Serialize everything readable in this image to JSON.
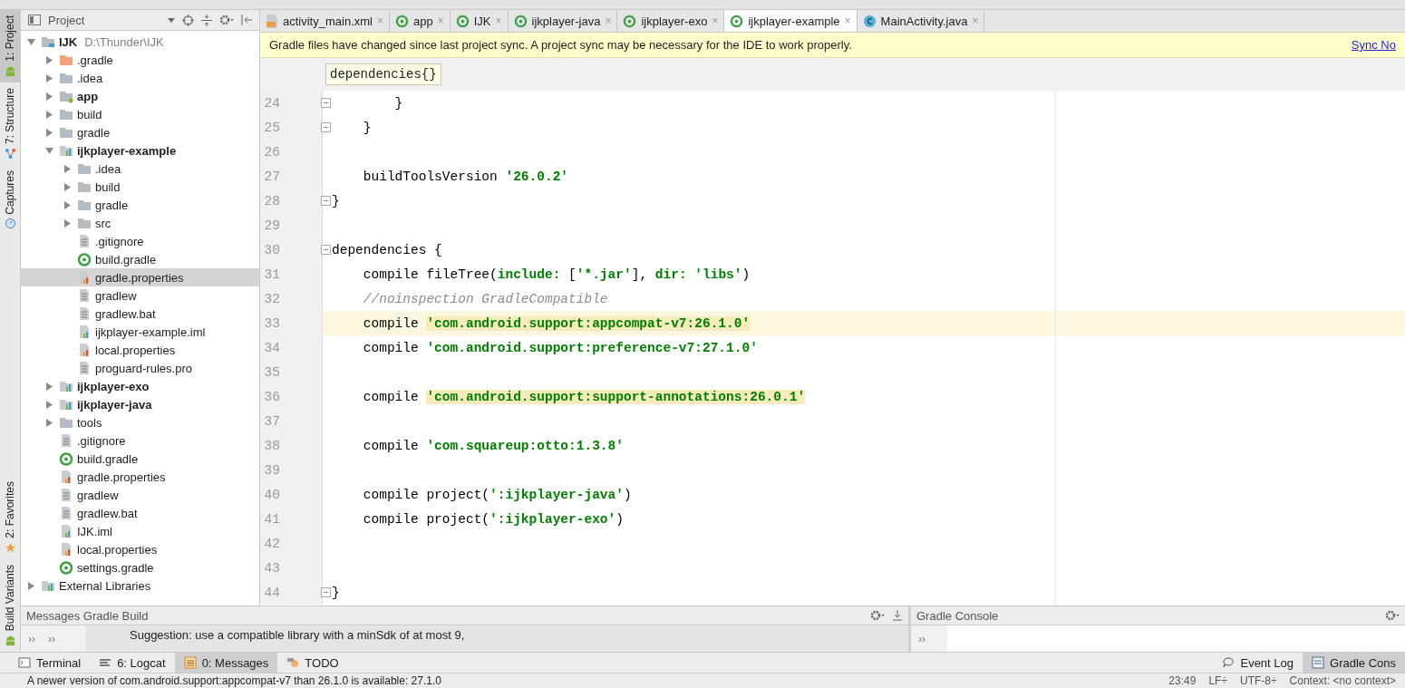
{
  "tool_strip": [
    {
      "label": "1: Project",
      "selected": true,
      "kind": "android"
    },
    {
      "label": "7: Structure",
      "selected": false,
      "kind": "structure"
    },
    {
      "label": "Captures",
      "selected": false,
      "kind": "camera"
    }
  ],
  "tool_strip_bottom": [
    {
      "label": "2: Favorites",
      "selected": false,
      "kind": "star"
    },
    {
      "label": "Build Variants",
      "selected": false,
      "kind": "android"
    }
  ],
  "project_panel": {
    "title": "Project",
    "tree": [
      {
        "label": "IJK",
        "path": "D:\\Thunder\\IJK",
        "kind": "project",
        "bold": true,
        "expanded": true,
        "selected": false,
        "children": [
          {
            "label": ".gradle",
            "kind": "folder-orange",
            "bold": false,
            "expanded": false,
            "selected": false
          },
          {
            "label": ".idea",
            "kind": "folder",
            "bold": false,
            "expanded": false,
            "selected": false
          },
          {
            "label": "app",
            "kind": "module-folder",
            "bold": true,
            "expanded": false,
            "selected": false
          },
          {
            "label": "build",
            "kind": "folder",
            "bold": false,
            "expanded": false,
            "selected": false
          },
          {
            "label": "gradle",
            "kind": "folder",
            "bold": false,
            "expanded": false,
            "selected": false
          },
          {
            "label": "ijkplayer-example",
            "kind": "module",
            "bold": true,
            "expanded": true,
            "selected": false,
            "children": [
              {
                "label": ".idea",
                "kind": "folder",
                "bold": false,
                "expanded": false,
                "selected": false
              },
              {
                "label": "build",
                "kind": "folder",
                "bold": false,
                "expanded": false,
                "selected": false
              },
              {
                "label": "gradle",
                "kind": "folder",
                "bold": false,
                "expanded": false,
                "selected": false
              },
              {
                "label": "src",
                "kind": "folder",
                "bold": false,
                "expanded": false,
                "selected": false
              },
              {
                "label": ".gitignore",
                "kind": "text",
                "bold": false,
                "selected": false
              },
              {
                "label": "build.gradle",
                "kind": "gradle",
                "bold": false,
                "selected": false
              },
              {
                "label": "gradle.properties",
                "kind": "properties",
                "bold": false,
                "selected": true
              },
              {
                "label": "gradlew",
                "kind": "text",
                "bold": false,
                "selected": false
              },
              {
                "label": "gradlew.bat",
                "kind": "text",
                "bold": false,
                "selected": false
              },
              {
                "label": "ijkplayer-example.iml",
                "kind": "iml",
                "bold": false,
                "selected": false
              },
              {
                "label": "local.properties",
                "kind": "properties",
                "bold": false,
                "selected": false
              },
              {
                "label": "proguard-rules.pro",
                "kind": "text",
                "bold": false,
                "selected": false
              }
            ]
          },
          {
            "label": "ijkplayer-exo",
            "kind": "module",
            "bold": true,
            "expanded": false,
            "selected": false
          },
          {
            "label": "ijkplayer-java",
            "kind": "module",
            "bold": true,
            "expanded": false,
            "selected": false
          },
          {
            "label": "tools",
            "kind": "folder",
            "bold": false,
            "expanded": false,
            "selected": false
          },
          {
            "label": ".gitignore",
            "kind": "text",
            "bold": false,
            "selected": false
          },
          {
            "label": "build.gradle",
            "kind": "gradle",
            "bold": false,
            "selected": false
          },
          {
            "label": "gradle.properties",
            "kind": "properties",
            "bold": false,
            "selected": false
          },
          {
            "label": "gradlew",
            "kind": "text",
            "bold": false,
            "selected": false
          },
          {
            "label": "gradlew.bat",
            "kind": "text",
            "bold": false,
            "selected": false
          },
          {
            "label": "IJK.iml",
            "kind": "iml-project",
            "bold": false,
            "selected": false
          },
          {
            "label": "local.properties",
            "kind": "properties",
            "bold": false,
            "selected": false
          },
          {
            "label": "settings.gradle",
            "kind": "gradle",
            "bold": false,
            "selected": false
          }
        ]
      },
      {
        "label": "External Libraries",
        "kind": "libraries",
        "bold": false,
        "expanded": false,
        "selected": false
      }
    ]
  },
  "editor_tabs": [
    {
      "label": "activity_main.xml",
      "kind": "xml",
      "close": "×",
      "selected": false
    },
    {
      "label": "app",
      "kind": "gradle",
      "close": "×",
      "selected": false
    },
    {
      "label": "IJK",
      "kind": "gradle",
      "close": "×",
      "selected": false
    },
    {
      "label": "ijkplayer-java",
      "kind": "gradle",
      "close": "×",
      "selected": false
    },
    {
      "label": "ijkplayer-exo",
      "kind": "gradle",
      "close": "×",
      "selected": false
    },
    {
      "label": "ijkplayer-example",
      "kind": "gradle",
      "close": "×",
      "selected": true
    },
    {
      "label": "MainActivity.java",
      "kind": "class",
      "close": "×",
      "selected": false
    }
  ],
  "notification": {
    "message": "Gradle files have changed since last project sync. A project sync may be necessary for the IDE to work properly.",
    "link": "Sync No"
  },
  "breadcrumb_popup": {
    "name": "dependencies",
    "braces": "{}"
  },
  "code_lines": [
    {
      "number": "24",
      "fold": true,
      "current": false,
      "tokens": [
        {
          "kind": "plain",
          "text": "        }"
        }
      ]
    },
    {
      "number": "25",
      "fold": true,
      "current": false,
      "tokens": [
        {
          "kind": "plain",
          "text": "    }"
        }
      ]
    },
    {
      "number": "26",
      "fold": false,
      "current": false
    },
    {
      "number": "27",
      "fold": false,
      "current": false,
      "tokens": [
        {
          "kind": "plain",
          "text": "    buildToolsVersion "
        },
        {
          "kind": "string",
          "text": "'26.0.2'"
        }
      ]
    },
    {
      "number": "28",
      "fold": true,
      "current": false,
      "tokens": [
        {
          "kind": "plain",
          "text": "}"
        }
      ]
    },
    {
      "number": "29",
      "fold": false,
      "current": false
    },
    {
      "number": "30",
      "fold": true,
      "current": false,
      "tokens": [
        {
          "kind": "plain",
          "text": "dependencies {"
        }
      ]
    },
    {
      "number": "31",
      "fold": false,
      "current": false,
      "tokens": [
        {
          "kind": "plain",
          "text": "    compile fileTree("
        },
        {
          "kind": "named",
          "text": "include: "
        },
        {
          "kind": "plain",
          "text": "["
        },
        {
          "kind": "string",
          "text": "'*.jar'"
        },
        {
          "kind": "plain",
          "text": "], "
        },
        {
          "kind": "named",
          "text": "dir: "
        },
        {
          "kind": "string",
          "text": "'libs'"
        },
        {
          "kind": "plain",
          "text": ")"
        }
      ]
    },
    {
      "number": "32",
      "fold": false,
      "current": false,
      "tokens": [
        {
          "kind": "comment",
          "text": "    //noinspection GradleCompatible"
        }
      ]
    },
    {
      "number": "33",
      "fold": false,
      "current": true,
      "tokens": [
        {
          "kind": "plain",
          "text": "    compile "
        },
        {
          "kind": "string-marked",
          "text": "'com.android.support:appcompat-v7:26.1.0'"
        }
      ]
    },
    {
      "number": "34",
      "fold": false,
      "current": false,
      "tokens": [
        {
          "kind": "plain",
          "text": "    compile "
        },
        {
          "kind": "string",
          "text": "'com.android.support:preference-v7:27.1.0'"
        }
      ]
    },
    {
      "number": "35",
      "fold": false,
      "current": false
    },
    {
      "number": "36",
      "fold": false,
      "current": false,
      "tokens": [
        {
          "kind": "plain",
          "text": "    compile "
        },
        {
          "kind": "string-marked",
          "text": "'com.android.support:support-annotations:26.0.1'"
        }
      ]
    },
    {
      "number": "37",
      "fold": false,
      "current": false
    },
    {
      "number": "38",
      "fold": false,
      "current": false,
      "tokens": [
        {
          "kind": "plain",
          "text": "    compile "
        },
        {
          "kind": "string",
          "text": "'com.squareup:otto:1.3.8'"
        }
      ]
    },
    {
      "number": "39",
      "fold": false,
      "current": false
    },
    {
      "number": "40",
      "fold": false,
      "current": false,
      "tokens": [
        {
          "kind": "plain",
          "text": "    compile project("
        },
        {
          "kind": "string",
          "text": "':ijkplayer-java'"
        },
        {
          "kind": "plain",
          "text": ")"
        }
      ]
    },
    {
      "number": "41",
      "fold": false,
      "current": false,
      "tokens": [
        {
          "kind": "plain",
          "text": "    compile project("
        },
        {
          "kind": "string",
          "text": "':ijkplayer-exo'"
        },
        {
          "kind": "plain",
          "text": ")"
        }
      ]
    },
    {
      "number": "42",
      "fold": false,
      "current": false
    },
    {
      "number": "43",
      "fold": false,
      "current": false
    },
    {
      "number": "44",
      "fold": true,
      "current": false,
      "tokens": [
        {
          "kind": "plain",
          "text": "}"
        }
      ]
    }
  ],
  "messages_panel": {
    "title": "Messages Gradle Build",
    "expand_buttons": [
      "››",
      "››"
    ],
    "message": "Suggestion: use a compatible library with a minSdk of at most 9,"
  },
  "console_panel": {
    "title": "Gradle Console",
    "expand_button": "››"
  },
  "bottom_tabs": [
    {
      "label": "Terminal",
      "kind": "terminal",
      "selected": false
    },
    {
      "label": "6: Logcat",
      "kind": "logcat",
      "selected": false
    },
    {
      "label": "0: Messages",
      "kind": "messages",
      "selected": true
    },
    {
      "label": "TODO",
      "kind": "todo",
      "selected": false
    }
  ],
  "bottom_tabs_right": [
    {
      "label": "Event Log",
      "kind": "event",
      "selected": false
    },
    {
      "label": "Gradle Cons",
      "kind": "console",
      "selected": true
    }
  ],
  "status_bar": {
    "message": "A newer version of com.android.support:appcompat-v7 than 26.1.0 is available: 27.1.0",
    "items": [
      "23:49",
      "LF÷",
      "UTF-8÷",
      "Context: <no context>"
    ]
  }
}
